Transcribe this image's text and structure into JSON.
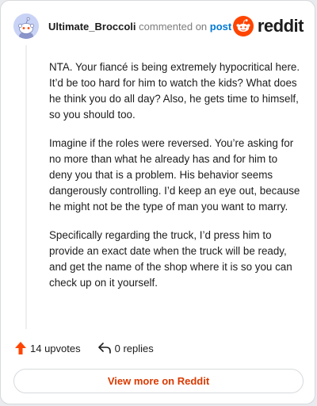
{
  "header": {
    "username": "Ultimate_Broccoli",
    "verb": "commented on",
    "post_link": "post",
    "logo_text": "reddit",
    "avatar_icon": "snoo-avatar-icon",
    "logo_icon": "reddit-snoo-icon"
  },
  "comment": {
    "paragraphs": [
      "NTA. Your fiancé is being extremely hypocritical here. It’d be too hard for him to watch the kids? What does he think you do all day? Also, he gets time to himself, so you should too.",
      "Imagine if the roles were reversed. You’re asking for no more than what he already has and for him to deny you that is a problem. His behavior seems dangerously controlling. I’d keep an eye out, because he might not be the type of man you want to marry.",
      "Specifically regarding the truck, I’d press him to provide an exact date when the truck will be ready, and get the name of the shop where it is so you can check up on it yourself."
    ]
  },
  "footer": {
    "upvotes_label": "14 upvotes",
    "replies_label": "0 replies",
    "upvote_icon": "upvote-arrow-icon",
    "reply_icon": "reply-arrow-icon"
  },
  "actions": {
    "view_more_label": "View more on Reddit"
  },
  "colors": {
    "brand": "#ff4500",
    "link": "#0079d3",
    "button_text": "#d93a00",
    "avatar_bg": "#c9d3f5"
  }
}
